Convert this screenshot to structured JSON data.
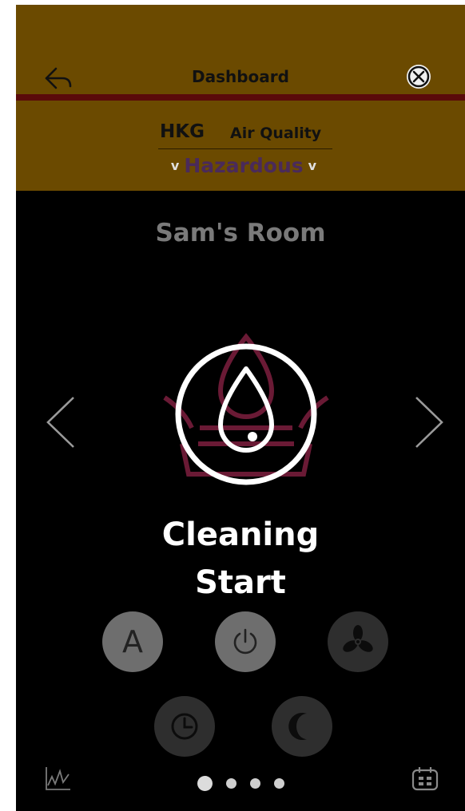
{
  "header": {
    "title": "Dashboard",
    "back_icon": "back-arrow-icon",
    "close_icon": "close-icon",
    "background_color": "#6b4a00",
    "rule_color": "#5a0a0a"
  },
  "air_quality": {
    "city": "HKG",
    "label": "Air Quality",
    "status": "Hazardous",
    "status_color": "#4a2a5a"
  },
  "room": {
    "name": "Sam's Room"
  },
  "device": {
    "status_line_1": "Cleaning",
    "status_line_2": "Start",
    "icon": "water-drop-icon"
  },
  "controls": {
    "auto_label": "A",
    "items": [
      {
        "name": "auto",
        "icon": "auto-mode-icon",
        "active": true
      },
      {
        "name": "power",
        "icon": "power-icon",
        "active": true
      },
      {
        "name": "fan",
        "icon": "fan-icon",
        "active": false
      },
      {
        "name": "timer",
        "icon": "clock-icon",
        "active": false
      },
      {
        "name": "sleep",
        "icon": "moon-icon",
        "active": false
      }
    ]
  },
  "pager": {
    "total": 4,
    "current": 1
  },
  "bottom_bar": {
    "left_icon": "chart-icon",
    "right_icon": "calendar-icon"
  }
}
